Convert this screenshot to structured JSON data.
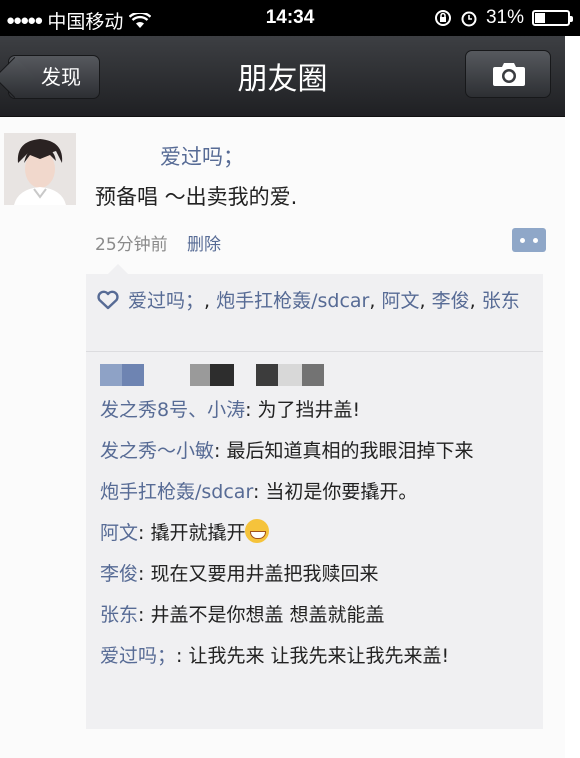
{
  "status_bar": {
    "carrier": "中国移动",
    "time": "14:34",
    "battery": "31%",
    "battery_level": 0.31
  },
  "nav": {
    "back_label": "发现",
    "title": "朋友圈",
    "camera_icon": "camera-icon"
  },
  "post": {
    "author": "爱过吗；",
    "text": "预备唱 ～出卖我的爱.",
    "time": "25分钟前",
    "delete_label": "删除"
  },
  "likes": {
    "names": [
      "爱过吗；",
      "炮手扛枪轰/sdcar",
      "阿文",
      "李俊",
      "张东"
    ]
  },
  "comments": [
    {
      "who": "发之秀8号、小涛",
      "text": "为了挡井盖!"
    },
    {
      "who": "发之秀～小敏",
      "text": "最后知道真相的我眼泪掉下来"
    },
    {
      "who": "炮手扛枪轰/sdcar",
      "text": "当初是你要撬开。"
    },
    {
      "who": "阿文",
      "text": "撬开就撬开"
    },
    {
      "who": "李俊",
      "text": "现在又要用井盖把我赎回来"
    },
    {
      "who": "张东",
      "text": "井盖不是你想盖  想盖就能盖"
    },
    {
      "who": "爱过吗；",
      "text": "让我先来 让我先来让我先来盖!"
    }
  ],
  "colors": {
    "link": "#576b95",
    "nav_bg": "#2d2f33",
    "comment_bg": "#f0f0f2"
  }
}
